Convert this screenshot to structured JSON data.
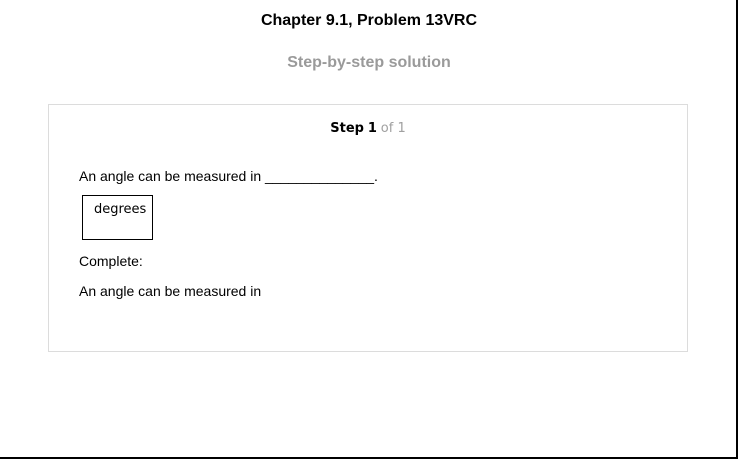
{
  "document": {
    "title": "Chapter 9.1, Problem 13VRC",
    "subtitle": "Step-by-step solution"
  },
  "step": {
    "label": "Step",
    "number": "1",
    "of_text": "of 1"
  },
  "content": {
    "question": "An angle can be measured in ______________.",
    "answer": "degrees",
    "complete_label": "Complete:",
    "completed_sentence": "An angle can be measured in"
  }
}
